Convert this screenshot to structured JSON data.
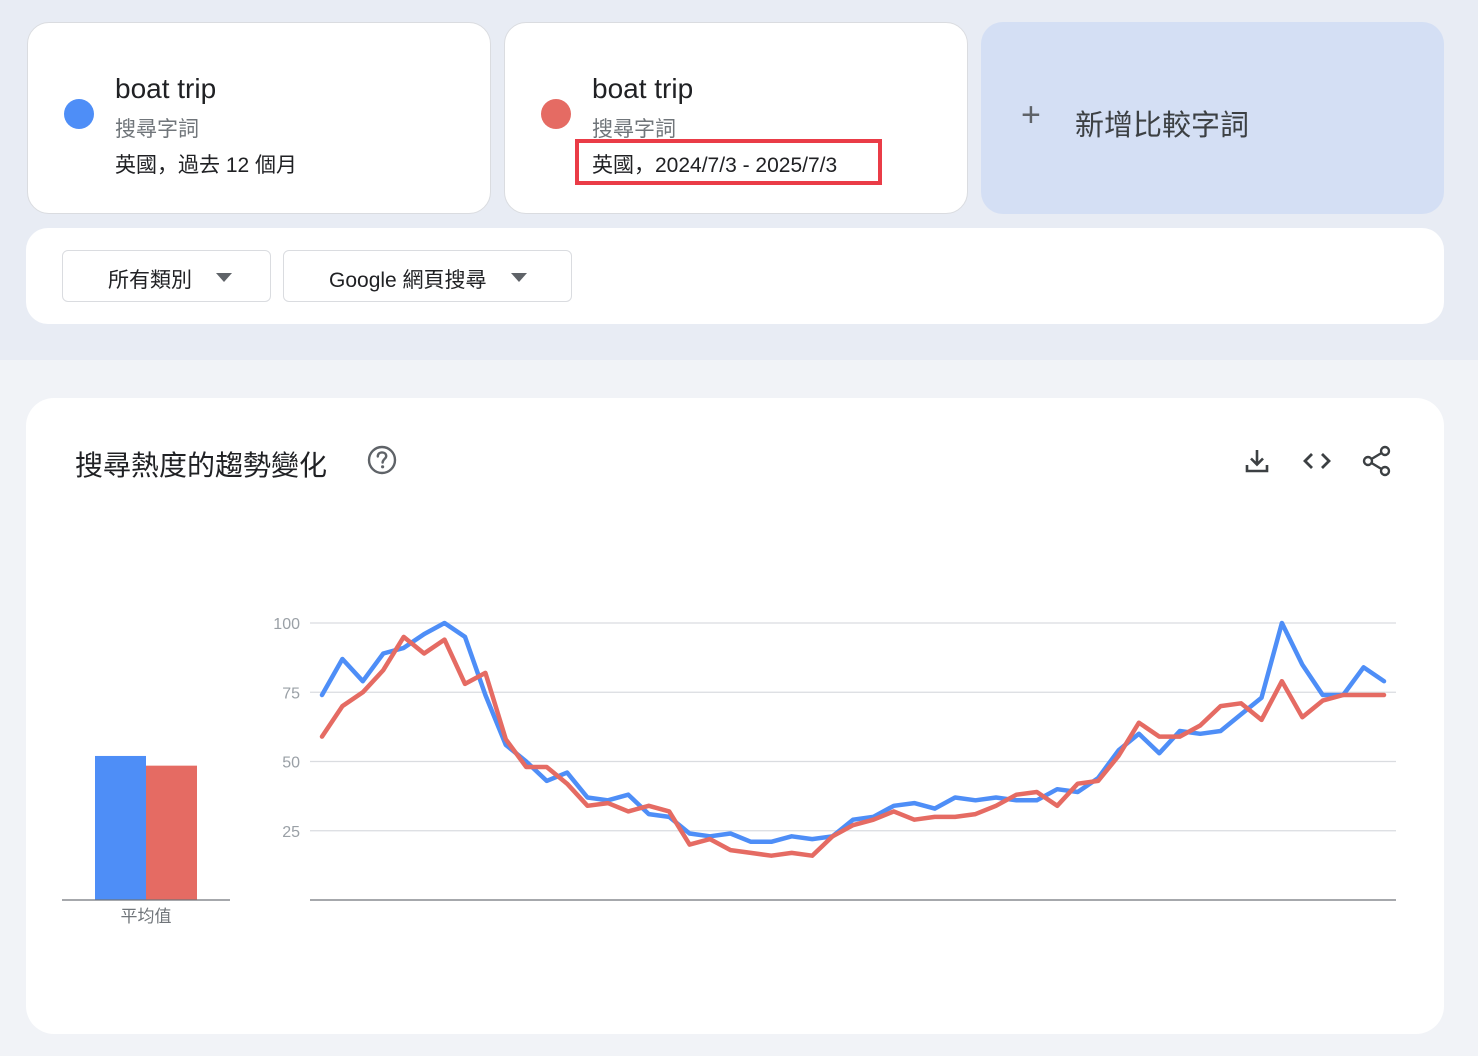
{
  "terms": [
    {
      "name": "boat trip",
      "type": "搜尋字詞",
      "meta": "英國，過去 12 個月",
      "color": "#4e8ef7"
    },
    {
      "name": "boat trip",
      "type": "搜尋字詞",
      "meta": "英國，2024/7/3 - 2025/7/3",
      "color": "#e56b63"
    }
  ],
  "add_compare": {
    "icon": "plus-icon",
    "label": "新增比較字詞"
  },
  "filters": [
    {
      "label": "所有類別",
      "icon": "caret-down-icon"
    },
    {
      "label": "Google 網頁搜尋",
      "icon": "caret-down-icon"
    }
  ],
  "panel": {
    "title": "搜尋熱度的趨勢變化",
    "help_icon": "help-icon",
    "tools": [
      "download-icon",
      "embed-code-icon",
      "share-icon"
    ]
  },
  "chart_data": [
    {
      "type": "bar",
      "categories": [
        "平均值"
      ],
      "series": [
        {
          "name": "boat trip",
          "values": [
            52
          ],
          "color": "#4e8ef7"
        },
        {
          "name": "boat trip",
          "values": [
            48.5
          ],
          "color": "#e56b63"
        }
      ],
      "ylim": [
        0,
        100
      ]
    },
    {
      "type": "line",
      "ylim": [
        0,
        100
      ],
      "yticks": [
        "25",
        "50",
        "75",
        "100"
      ],
      "grid": true,
      "series": [
        {
          "name": "boat trip",
          "color": "#4e8ef7",
          "values": [
            74,
            87,
            79,
            89,
            91,
            96,
            100,
            95,
            74,
            56,
            50,
            43,
            46,
            37,
            36,
            38,
            31,
            30,
            24,
            23,
            24,
            21,
            21,
            23,
            22,
            23,
            29,
            30,
            34,
            35,
            33,
            37,
            36,
            37,
            36,
            36,
            40,
            39,
            44,
            54,
            60,
            53,
            61,
            60,
            61,
            67,
            73,
            100,
            85,
            74,
            74,
            84,
            79
          ]
        },
        {
          "name": "boat trip",
          "color": "#e56b63",
          "values": [
            59,
            70,
            75,
            83,
            95,
            89,
            94,
            78,
            82,
            58,
            48,
            48,
            42,
            34,
            35,
            32,
            34,
            32,
            20,
            22,
            18,
            17,
            16,
            17,
            16,
            23,
            27,
            29,
            32,
            29,
            30,
            30,
            31,
            34,
            38,
            39,
            34,
            42,
            43,
            52,
            64,
            59,
            59,
            63,
            70,
            71,
            65,
            79,
            66,
            72,
            74,
            74,
            74
          ]
        }
      ]
    }
  ]
}
